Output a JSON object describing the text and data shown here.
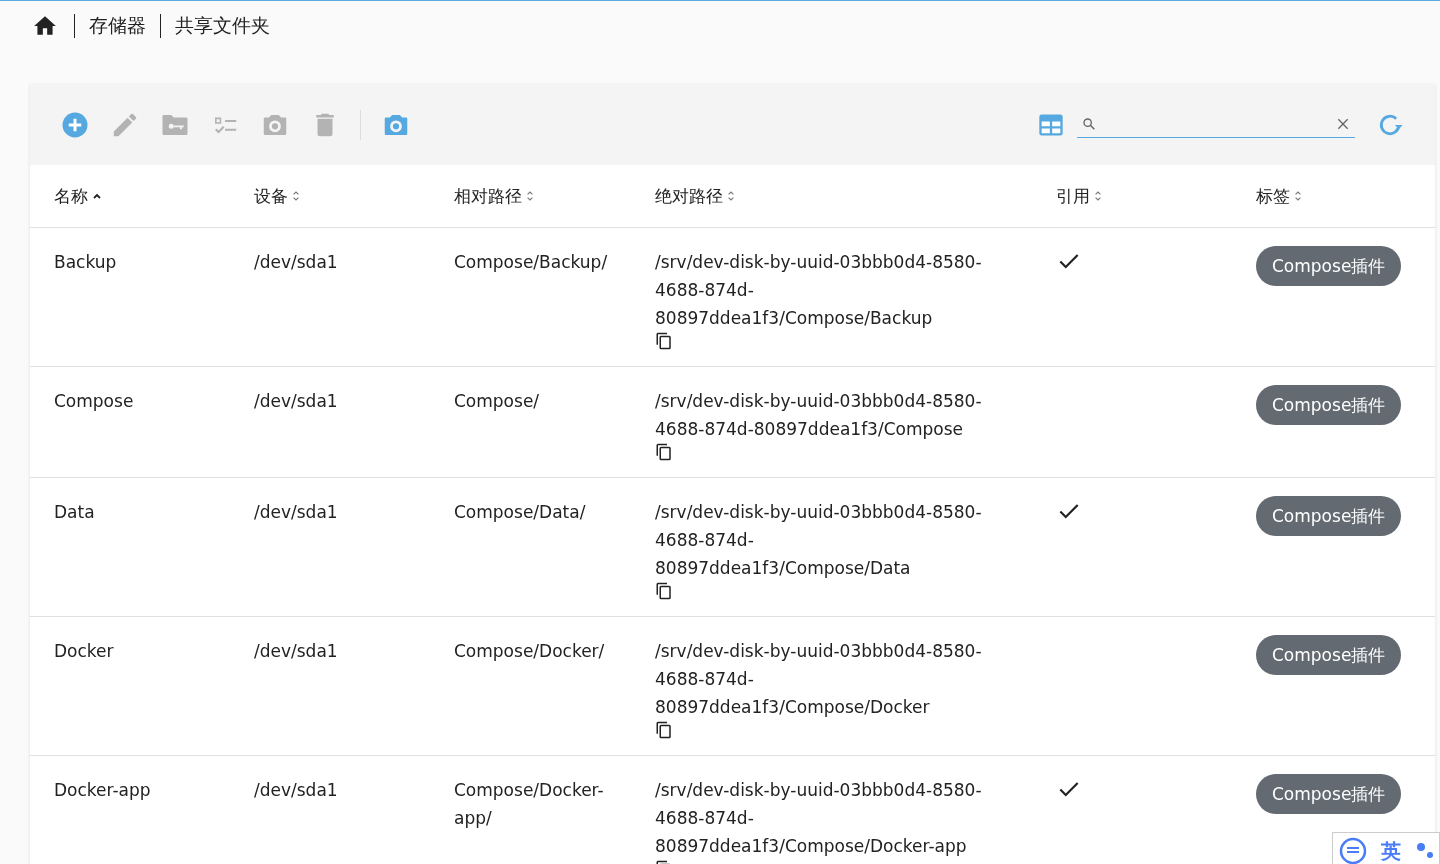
{
  "breadcrumb": [
    "存储器",
    "共享文件夹"
  ],
  "toolbar": {
    "actions": [
      {
        "kind": "add",
        "disabled": false
      },
      {
        "kind": "edit",
        "disabled": true
      },
      {
        "kind": "permissions",
        "disabled": true
      },
      {
        "kind": "acl",
        "disabled": true
      },
      {
        "kind": "snapshot",
        "disabled": true
      },
      {
        "kind": "delete",
        "disabled": true
      },
      {
        "kind": "snapshots",
        "disabled": false
      }
    ]
  },
  "table": {
    "columns": [
      {
        "label": "名称",
        "sorted": true
      },
      {
        "label": "设备",
        "sorted": false
      },
      {
        "label": "相对路径",
        "sorted": false
      },
      {
        "label": "绝对路径",
        "sorted": false
      },
      {
        "label": "引用",
        "sorted": false
      },
      {
        "label": "标签",
        "sorted": false
      }
    ],
    "rows": [
      {
        "name": "Backup",
        "device": "/dev/sda1",
        "relative_path": "Compose/Backup/",
        "absolute_path": "/srv/dev-disk-by-uuid-03bbb0d4-8580-4688-874d-80897ddea1f3/Compose/Backup",
        "referenced": true,
        "tag": "Compose插件"
      },
      {
        "name": "Compose",
        "device": "/dev/sda1",
        "relative_path": "Compose/",
        "absolute_path": "/srv/dev-disk-by-uuid-03bbb0d4-8580-4688-874d-80897ddea1f3/Compose",
        "referenced": false,
        "tag": "Compose插件"
      },
      {
        "name": "Data",
        "device": "/dev/sda1",
        "relative_path": "Compose/Data/",
        "absolute_path": "/srv/dev-disk-by-uuid-03bbb0d4-8580-4688-874d-80897ddea1f3/Compose/Data",
        "referenced": true,
        "tag": "Compose插件"
      },
      {
        "name": "Docker",
        "device": "/dev/sda1",
        "relative_path": "Compose/Docker/",
        "absolute_path": "/srv/dev-disk-by-uuid-03bbb0d4-8580-4688-874d-80897ddea1f3/Compose/Docker",
        "referenced": false,
        "tag": "Compose插件"
      },
      {
        "name": "Docker-app",
        "device": "/dev/sda1",
        "relative_path": "Compose/Docker-app/",
        "absolute_path": "/srv/dev-disk-by-uuid-03bbb0d4-8580-4688-874d-80897ddea1f3/Compose/Docker-app",
        "referenced": true,
        "tag": "Compose插件"
      }
    ]
  },
  "ime": {
    "mode": "英"
  }
}
